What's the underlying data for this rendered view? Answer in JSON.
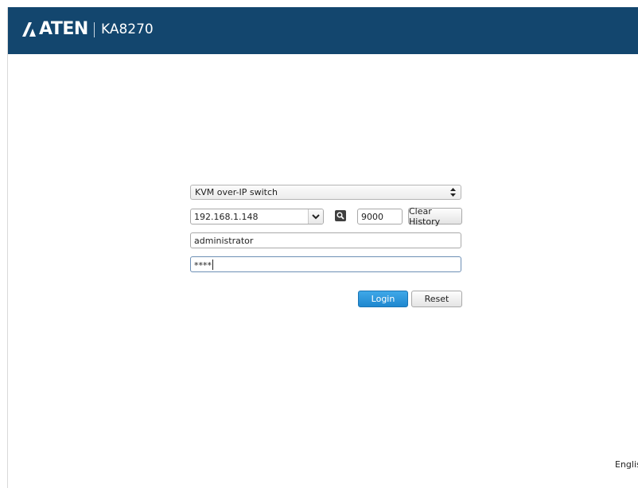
{
  "header": {
    "logo": "ATEN",
    "model": "KA8270",
    "background_color": "#13466e"
  },
  "login_form": {
    "device_type_selected": "KVM over-IP switch",
    "ip_address": "192.168.1.148",
    "port": "9000",
    "clear_history_label": "Clear History",
    "username": "administrator",
    "password_masked": "****",
    "login_label": "Login",
    "reset_label": "Reset",
    "login_button_color": "#2a97dc"
  },
  "icons": {
    "type_select": "updown-arrows-icon",
    "ip_dropdown": "chevron-down-icon",
    "search": "magnifier-icon"
  },
  "footer": {
    "language": "English"
  }
}
